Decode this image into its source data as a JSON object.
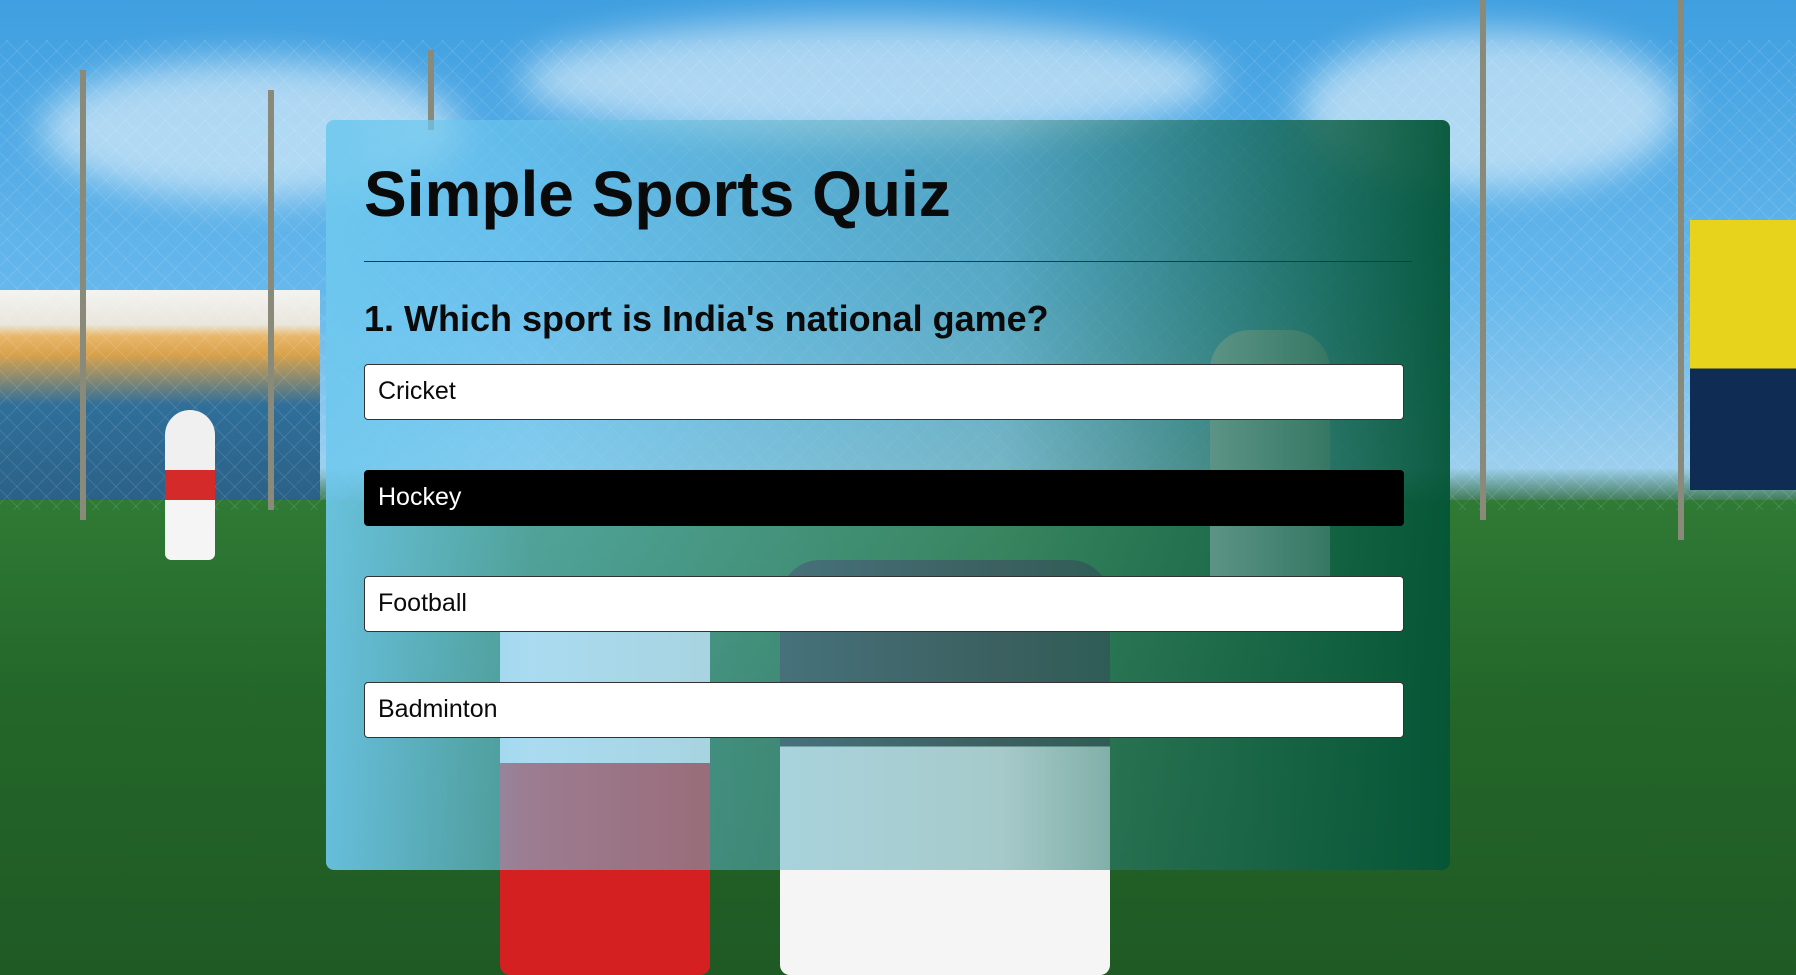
{
  "quiz": {
    "title": "Simple Sports Quiz",
    "question": "1. Which sport is India's national game?",
    "answers": [
      {
        "label": "Cricket",
        "selected": false
      },
      {
        "label": "Hockey",
        "selected": true
      },
      {
        "label": "Football",
        "selected": false
      },
      {
        "label": "Badminton",
        "selected": false
      }
    ]
  },
  "colors": {
    "selected_answer_bg": "#000000",
    "answer_bg": "#ffffff",
    "panel_gradient_start": "#6ec8ee",
    "panel_gradient_end": "#045537"
  },
  "background": {
    "description_icon": "soccer-field-photo"
  }
}
